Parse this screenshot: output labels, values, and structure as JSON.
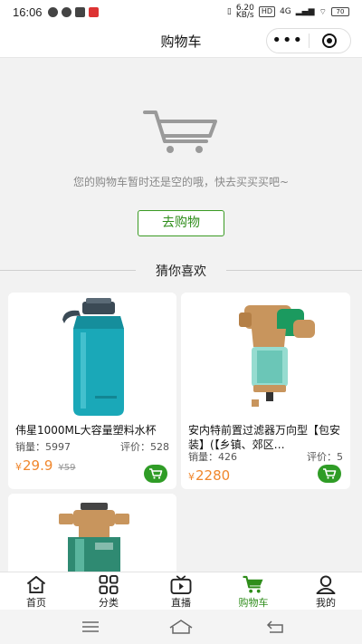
{
  "status_bar": {
    "time": "16:06",
    "network_speed": "6.20\nKB/s",
    "hd_badge": "HD",
    "network_type": "4G",
    "battery": "70"
  },
  "navbar": {
    "title": "购物车",
    "more_icon": "more-dots-icon",
    "close_icon": "target-icon"
  },
  "empty_cart": {
    "icon": "cart-icon",
    "message": "您的购物车暂时还是空的哦，快去买买买吧~",
    "go_shopping_label": "去购物"
  },
  "recommend": {
    "title": "猜你喜欢",
    "products": [
      {
        "name": "伟星1000ML大容量塑料水杯",
        "sales_label": "销量：5997",
        "reviews_label": "评价：528",
        "currency": "¥",
        "price": "29.9",
        "original_price": "¥59"
      },
      {
        "name": "安内特前置过滤器万向型【包安装】(【乡镇、郊区…",
        "sales_label": "销量：426",
        "reviews_label": "评价：5",
        "currency": "¥",
        "price": "2280"
      },
      {
        "name": "",
        "sales_label": "",
        "reviews_label": ""
      }
    ]
  },
  "tabbar": {
    "items": [
      {
        "label": "首页",
        "icon": "home-icon",
        "active": false
      },
      {
        "label": "分类",
        "icon": "category-icon",
        "active": false
      },
      {
        "label": "直播",
        "icon": "live-tv-icon",
        "active": false
      },
      {
        "label": "购物车",
        "icon": "cart-icon",
        "active": true
      },
      {
        "label": "我的",
        "icon": "user-icon",
        "active": false
      }
    ]
  },
  "colors": {
    "accent_green": "#2f9c26",
    "price_orange": "#f0872d",
    "background": "#f2f2f2"
  }
}
